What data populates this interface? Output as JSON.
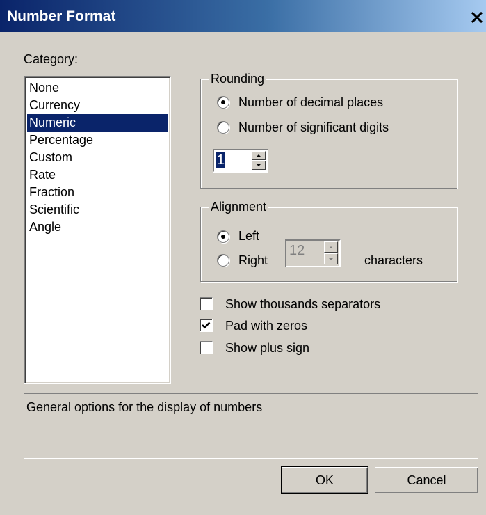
{
  "window": {
    "title": "Number Format"
  },
  "category": {
    "label": "Category:",
    "items": [
      "None",
      "Currency",
      "Numeric",
      "Percentage",
      "Custom",
      "Rate",
      "Fraction",
      "Scientific",
      "Angle"
    ],
    "selected": "Numeric"
  },
  "rounding": {
    "title": "Rounding",
    "option_decimal": "Number of decimal places",
    "option_significant": "Number of significant digits",
    "selected": "decimal",
    "value": "1"
  },
  "alignment": {
    "title": "Alignment",
    "option_left": "Left",
    "option_right": "Right",
    "selected": "left",
    "width_value": "12",
    "units_label": "characters"
  },
  "options": {
    "thousands": {
      "label": "Show thousands separators",
      "checked": false
    },
    "pad_zeros": {
      "label": "Pad with zeros",
      "checked": true
    },
    "plus_sign": {
      "label": "Show plus sign",
      "checked": false
    }
  },
  "description": "General options for the display of numbers",
  "buttons": {
    "ok": "OK",
    "cancel": "Cancel"
  },
  "colors": {
    "title_bar": "#0a246a",
    "face": "#d4d0c8",
    "selection": "#0a246a"
  }
}
